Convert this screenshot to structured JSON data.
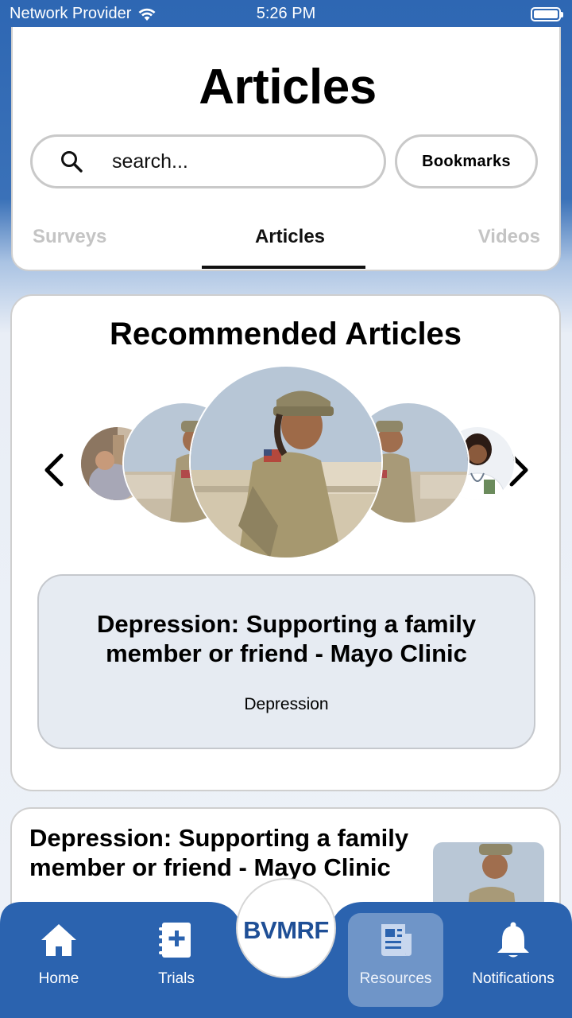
{
  "status_bar": {
    "carrier": "Network Provider",
    "time": "5:26 PM"
  },
  "header": {
    "title": "Articles",
    "search_placeholder": "search...",
    "bookmarks_label": "Bookmarks",
    "tabs": [
      {
        "label": "Surveys",
        "active": false
      },
      {
        "label": "Articles",
        "active": true
      },
      {
        "label": "Videos",
        "active": false
      }
    ]
  },
  "recommended": {
    "title": "Recommended Articles",
    "featured": {
      "title": "Depression: Supporting a family member or friend - Mayo Clinic",
      "tag": "Depression"
    }
  },
  "list": {
    "items": [
      {
        "title": "Depression: Supporting a family member or friend - Mayo Clinic"
      }
    ]
  },
  "bottom_nav": {
    "logo": "BVMRF",
    "items": [
      {
        "label": "Home",
        "icon": "home-icon"
      },
      {
        "label": "Trials",
        "icon": "trials-icon"
      },
      {
        "label": "Resources",
        "icon": "resources-icon",
        "active": true
      },
      {
        "label": "Notifications",
        "icon": "bell-icon"
      }
    ]
  },
  "colors": {
    "brand_blue": "#2b63af",
    "active_tab": "#111111",
    "inactive_tab": "#c4c4c4",
    "featured_bg": "#e6ebf2"
  }
}
